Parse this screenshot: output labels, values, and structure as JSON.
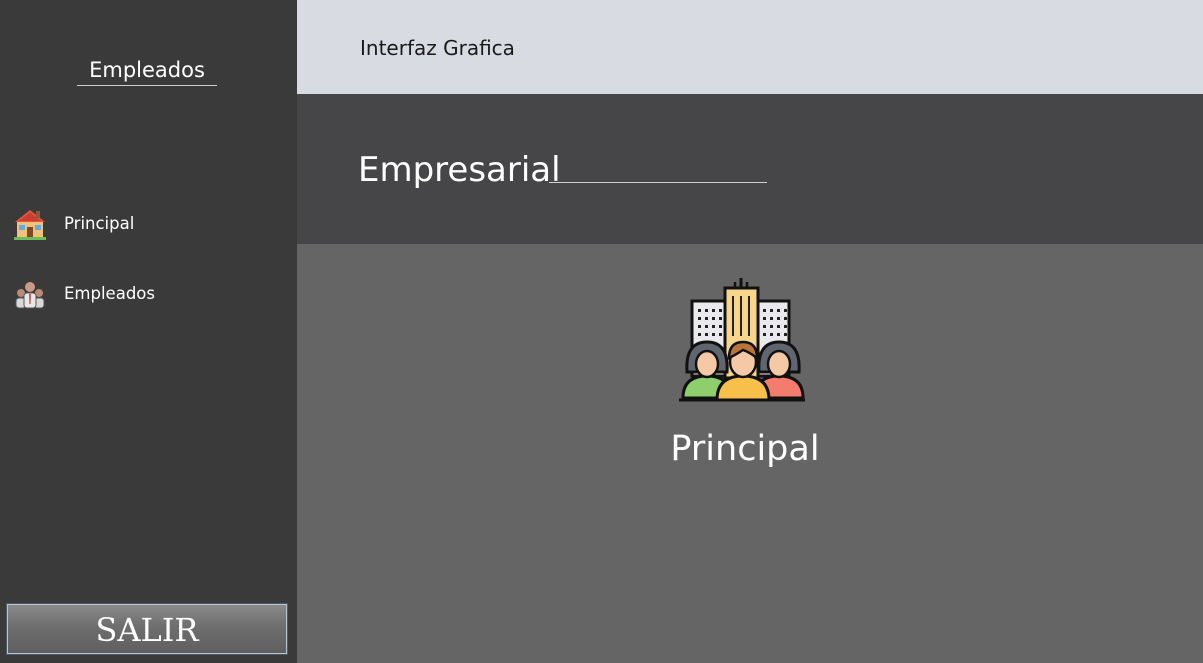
{
  "sidebar": {
    "title": "Empleados",
    "items": [
      {
        "label": "Principal",
        "icon": "house-icon"
      },
      {
        "label": "Empleados",
        "icon": "employees-icon"
      }
    ],
    "exit_label": "SALIR"
  },
  "header": {
    "title": "Interfaz Grafica"
  },
  "section": {
    "title": "Empresarial"
  },
  "main": {
    "hero_label": "Principal",
    "hero_icon": "company-team-icon"
  },
  "colors": {
    "sidebar_bg": "#3a3a3a",
    "header_bg": "#d8dbe2",
    "subheader_bg": "#464648",
    "main_bg": "#656565"
  }
}
